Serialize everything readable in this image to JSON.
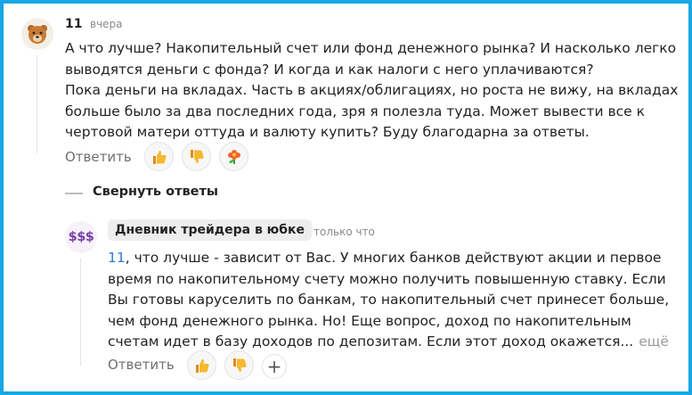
{
  "comment": {
    "author": "11",
    "time": "вчера",
    "lines": [
      "А что лучше? Накопительный счет или фонд денежного рынка? И насколько легко",
      "выводятся деньги с фонда? И когда и как налоги с него уплачиваются?",
      "Пока деньги на вкладах. Часть в акциях/облигациях, но роста не вижу, на вкладах",
      "больше было за два последних года, зря я полезла туда. Может вывести все к",
      "чертовой матери оттуда и валюту купить? Буду благодарна за ответы."
    ],
    "reply_label": "Ответить",
    "reactions": [
      "thumbs-up-icon",
      "thumbs-down-icon",
      "flower-icon"
    ]
  },
  "collapse_label": "Свернуть ответы",
  "reply": {
    "author": "Дневник трейдера в юбке",
    "time": "только что",
    "avatar_text": "$$$",
    "mention": "11",
    "first_line_rest": ", что лучше - зависит от Вас. У многих банков действуют акции и первое",
    "lines": [
      "время по накопительному счету можно получить повышенную ставку. Если",
      "Вы готовы каруселить по банкам, то накопительный счет принесет больше,",
      "чем фонд денежного рынка. Но! Еще вопрос, доход по накопительным",
      "счетам идет в базу доходов по депозитам. Если этот доход окажется..."
    ],
    "more_label": "ещё",
    "reply_label": "Ответить",
    "reactions": [
      "thumbs-up-icon",
      "thumbs-down-icon",
      "add-reaction-icon"
    ],
    "add_symbol": "+"
  },
  "colors": {
    "frame": "#17a7e3",
    "mention": "#2f7bc9",
    "avatar_dollar": "#7b3fa8"
  }
}
